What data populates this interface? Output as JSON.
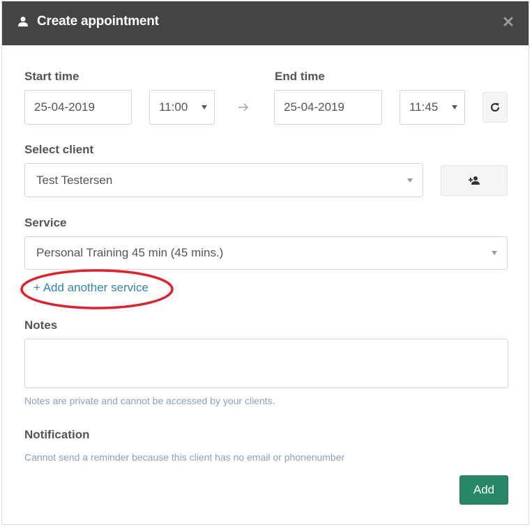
{
  "dialog": {
    "title": "Create appointment"
  },
  "start": {
    "label": "Start time",
    "date": "25-04-2019",
    "time": "11:00"
  },
  "end": {
    "label": "End time",
    "date": "25-04-2019",
    "time": "11:45"
  },
  "client": {
    "label": "Select client",
    "value": "Test Testersen"
  },
  "service": {
    "label": "Service",
    "value": "Personal Training 45 min (45 mins.)",
    "add_link": "+ Add another service",
    "highlight_color": "#e0202a"
  },
  "notes": {
    "label": "Notes",
    "value": "",
    "help": "Notes are private and cannot be accessed by your clients."
  },
  "notification": {
    "label": "Notification",
    "help": "Cannot send a reminder because this client has no email or phonenumber"
  },
  "actions": {
    "add_label": "Add"
  },
  "colors": {
    "header_bg": "#444444",
    "primary_button": "#268866",
    "link": "#2f86b4",
    "help_text": "#8aa2b3"
  },
  "icons": {
    "header": "user-icon",
    "close": "close-icon",
    "arrow": "arrow-right-icon",
    "refresh": "refresh-icon",
    "add_client": "add-user-icon"
  }
}
